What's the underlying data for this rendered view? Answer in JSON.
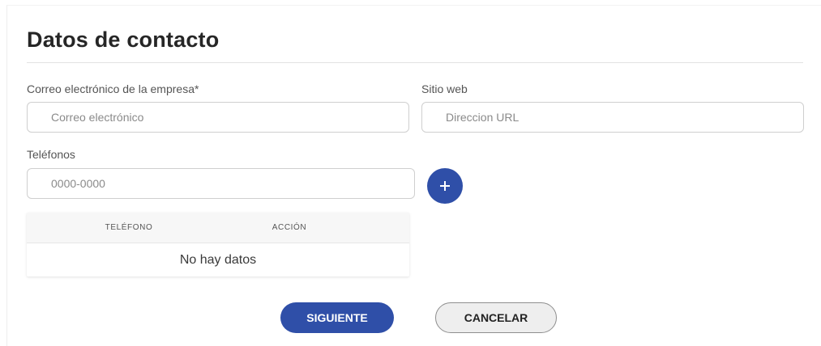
{
  "section": {
    "title": "Datos de contacto"
  },
  "form": {
    "email": {
      "label": "Correo electrónico de la empresa*",
      "placeholder": "Correo electrónico",
      "value": ""
    },
    "website": {
      "label": "Sitio web",
      "placeholder": "Direccion URL",
      "value": ""
    },
    "phones": {
      "label": "Teléfonos",
      "placeholder": "0000-0000",
      "value": "",
      "add_icon": "plus-icon"
    }
  },
  "phones_table": {
    "columns": [
      "TELÉFONO",
      "ACCIÓN"
    ],
    "rows": [],
    "empty_text": "No hay datos"
  },
  "actions": {
    "next_label": "SIGUIENTE",
    "cancel_label": "CANCELAR"
  },
  "colors": {
    "primary": "#2f4fa8",
    "secondary_bg": "#eeeeee"
  }
}
